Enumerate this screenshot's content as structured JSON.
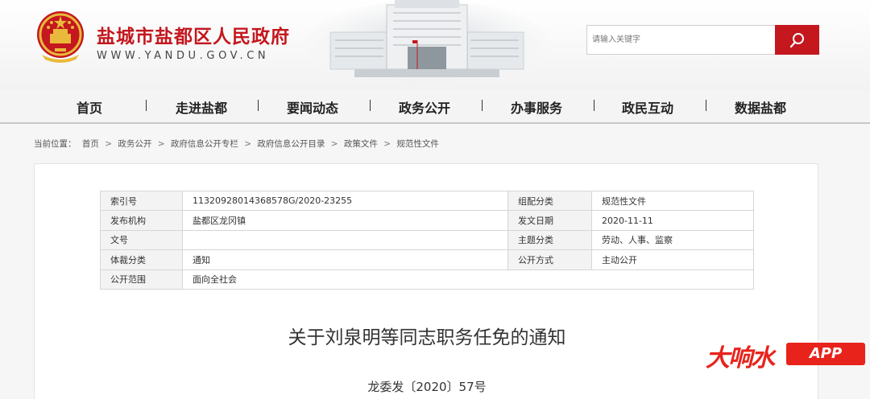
{
  "site": {
    "title": "盐城市盐都区人民政府",
    "url": "WWW.YANDU.GOV.CN"
  },
  "search": {
    "placeholder": "请输入关键字"
  },
  "nav": {
    "items": [
      "首页",
      "走进盐都",
      "要闻动态",
      "政务公开",
      "办事服务",
      "政民互动",
      "数据盐都"
    ]
  },
  "breadcrumb": {
    "prefix": "当前位置：",
    "items": [
      "首页",
      "政务公开",
      "政府信息公开专栏",
      "政府信息公开目录",
      "政策文件",
      "规范性文件"
    ],
    "separator": ">"
  },
  "meta": {
    "rows": [
      {
        "label1": "索引号",
        "value1": "11320928014368578G/2020-23255",
        "label2": "组配分类",
        "value2": "规范性文件"
      },
      {
        "label1": "发布机构",
        "value1": "盐都区龙冈镇",
        "label2": "发文日期",
        "value2": "2020-11-11"
      },
      {
        "label1": "文号",
        "value1": "",
        "label2": "主题分类",
        "value2": "劳动、人事、监察"
      },
      {
        "label1": "体裁分类",
        "value1": "通知",
        "label2": "公开方式",
        "value2": "主动公开"
      },
      {
        "label1": "公开范围",
        "value1": "面向全社会"
      }
    ]
  },
  "document": {
    "title": "关于刘泉明等同志职务任免的通知",
    "number": "龙委发〔2020〕57号"
  },
  "watermark": {
    "text": "大响水",
    "app": "APP"
  },
  "colors": {
    "brand_red": "#c4171e",
    "watermark_red": "#e8231b"
  }
}
